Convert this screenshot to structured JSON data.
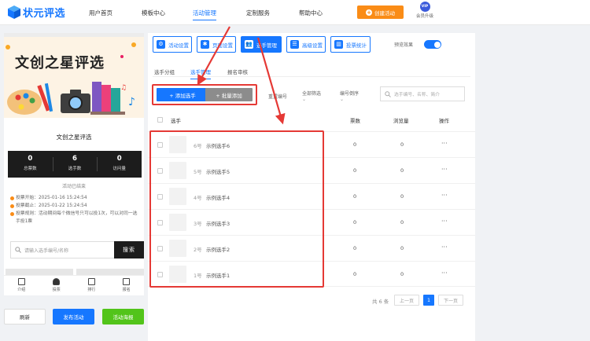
{
  "header": {
    "brand": "状元评选",
    "nav": [
      {
        "label": "用户首页"
      },
      {
        "label": "模板中心"
      },
      {
        "label": "活动管理"
      },
      {
        "label": "定制服务"
      },
      {
        "label": "帮助中心"
      }
    ],
    "active_nav": "活动管理",
    "create_button": "创建活动",
    "vip_badge": "VIP",
    "vip_label": "会员升级"
  },
  "preview": {
    "banner_title": "文创之星评选",
    "card_title": "文创之星评选",
    "stats": [
      {
        "value": "0",
        "label": "总票数"
      },
      {
        "value": "6",
        "label": "选手数"
      },
      {
        "value": "0",
        "label": "访问量"
      }
    ],
    "status": "活动已结束",
    "rules": [
      "投票开始：2025-01-16 15:24:54",
      "投票截止：2025-01-22 15:24:54",
      "投票规则：活动期间每个微信号只可以投1次，可以对同一选手投1票"
    ],
    "search_placeholder": "请输入选手编号/名称",
    "search_button": "搜索",
    "tabs": [
      {
        "label": "介绍"
      },
      {
        "label": "投票"
      },
      {
        "label": "排行"
      },
      {
        "label": "报名"
      }
    ],
    "active_tab": "投票"
  },
  "actions": {
    "refresh": "刷新",
    "publish": "发布活动",
    "poster": "活动海报"
  },
  "toolbar": {
    "buttons": [
      {
        "label": "活动设置"
      },
      {
        "label": "页面设置"
      },
      {
        "label": "选手管理"
      },
      {
        "label": "高级设置"
      },
      {
        "label": "投票统计"
      }
    ],
    "active": "选手管理",
    "preview_label": "预览效果",
    "preview_on": true
  },
  "subtabs": [
    {
      "label": "选手分组"
    },
    {
      "label": "选手管理"
    },
    {
      "label": "报名审核"
    }
  ],
  "active_subtab": "选手管理",
  "list_controls": {
    "add_button": "+ 添加选手",
    "batch_button": "+ 批量添加",
    "reset_numbering": "重置编号",
    "filter_all": "全部筛选",
    "sort_by_number": "编号倒序",
    "search_placeholder": "选手编号、名称、简介"
  },
  "table": {
    "columns": [
      "选手",
      "票数",
      "浏览量",
      "操作"
    ],
    "rows": [
      {
        "no": "6号",
        "name": "示例选手6",
        "votes": "0",
        "views": "0",
        "more": "···"
      },
      {
        "no": "5号",
        "name": "示例选手5",
        "votes": "0",
        "views": "0",
        "more": "···"
      },
      {
        "no": "4号",
        "name": "示例选手4",
        "votes": "0",
        "views": "0",
        "more": "···"
      },
      {
        "no": "3号",
        "name": "示例选手3",
        "votes": "0",
        "views": "0",
        "more": "···"
      },
      {
        "no": "2号",
        "name": "示例选手2",
        "votes": "0",
        "views": "0",
        "more": "···"
      },
      {
        "no": "1号",
        "name": "示例选手1",
        "votes": "0",
        "views": "0",
        "more": "···"
      }
    ]
  },
  "pagination": {
    "total": "共 6 条",
    "prev": "上一页",
    "current": "1",
    "next": "下一页"
  },
  "colors": {
    "primary": "#1677ff",
    "orange": "#fa8c16",
    "annotation_red": "#e53935",
    "green": "#52c41a"
  }
}
